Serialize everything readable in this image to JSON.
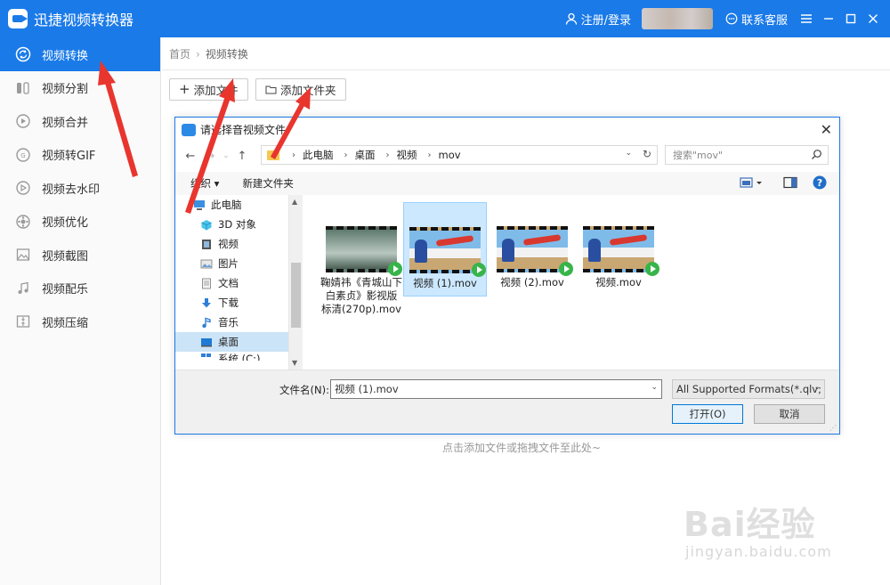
{
  "app": {
    "title": "迅捷视频转换器"
  },
  "titlebar": {
    "login_label": "注册/登录",
    "service_label": "联系客服"
  },
  "sidebar": {
    "items": [
      {
        "label": "视频转换",
        "icon": "convert-icon"
      },
      {
        "label": "视频分割",
        "icon": "split-icon"
      },
      {
        "label": "视频合并",
        "icon": "merge-icon"
      },
      {
        "label": "视频转GIF",
        "icon": "gif-icon"
      },
      {
        "label": "视频去水印",
        "icon": "watermark-icon"
      },
      {
        "label": "视频优化",
        "icon": "optimize-icon"
      },
      {
        "label": "视频截图",
        "icon": "screenshot-icon"
      },
      {
        "label": "视频配乐",
        "icon": "music-icon"
      },
      {
        "label": "视频压缩",
        "icon": "compress-icon"
      }
    ]
  },
  "main": {
    "breadcrumb": {
      "home": "首页",
      "current": "视频转换"
    },
    "add_file_label": "添加文件",
    "add_folder_label": "添加文件夹",
    "drop_hint": "点击添加文件或拖拽文件至此处~"
  },
  "dialog": {
    "title": "请选择音视频文件",
    "address": {
      "items": [
        "此电脑",
        "桌面",
        "视频",
        "mov"
      ]
    },
    "search_placeholder": "搜索\"mov\"",
    "toolbar": {
      "organize": "组织 ▾",
      "new_folder": "新建文件夹"
    },
    "tree": [
      {
        "label": "此电脑",
        "level": 0
      },
      {
        "label": "3D 对象",
        "level": 1
      },
      {
        "label": "视频",
        "level": 1
      },
      {
        "label": "图片",
        "level": 1
      },
      {
        "label": "文档",
        "level": 1
      },
      {
        "label": "下载",
        "level": 1
      },
      {
        "label": "音乐",
        "level": 1
      },
      {
        "label": "桌面",
        "level": 1,
        "selected": true
      },
      {
        "label": "系统 (C:)",
        "level": 1
      }
    ],
    "files": [
      {
        "name": "鞠婧祎《青城山下白素贞》影视版 标清(270p).mov",
        "thumb": "dark"
      },
      {
        "name": "视频 (1).mov",
        "thumb": "plane",
        "selected": true
      },
      {
        "name": "视频 (2).mov",
        "thumb": "plane"
      },
      {
        "name": "视频.mov",
        "thumb": "plane"
      }
    ],
    "filename_label": "文件名(N):",
    "filename_value": "视频 (1).mov",
    "format_value": "All Supported Formats(*.qlv;",
    "open_label": "打开(O)",
    "cancel_label": "取消"
  },
  "watermark": {
    "main": "Bai经验",
    "sub": "jingyan.baidu.com"
  },
  "colors": {
    "accent": "#1a7ae8",
    "annotation": "#e8352e"
  }
}
